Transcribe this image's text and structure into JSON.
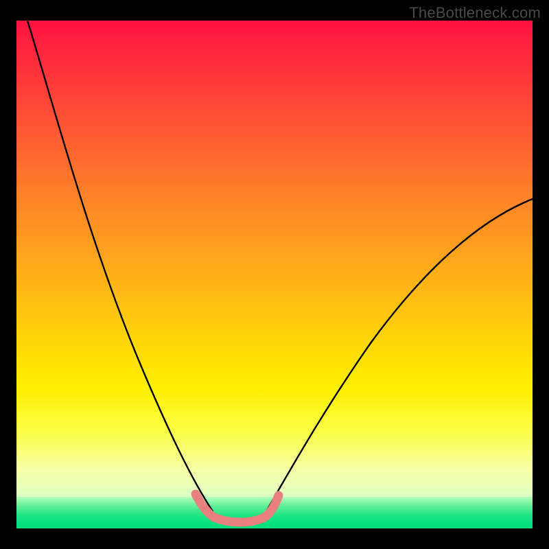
{
  "watermark": "TheBottleneck.com",
  "chart_data": {
    "type": "line",
    "title": "",
    "xlabel": "",
    "ylabel": "",
    "xlim": [
      0,
      100
    ],
    "ylim": [
      0,
      100
    ],
    "grid": false,
    "legend": false,
    "annotation_colors": {
      "top_gradient": "#ff1a3a",
      "mid_gradient": "#ffe000",
      "bottom_band": "#00e878"
    },
    "series": [
      {
        "name": "left-curve",
        "x": [
          2,
          6,
          10,
          15,
          20,
          25,
          30,
          34,
          37,
          40
        ],
        "y": [
          100,
          88,
          76,
          62,
          48,
          34,
          22,
          12,
          6,
          2
        ],
        "stroke": "#000000"
      },
      {
        "name": "right-curve",
        "x": [
          48,
          52,
          58,
          65,
          72,
          80,
          88,
          96,
          100
        ],
        "y": [
          2,
          6,
          14,
          24,
          34,
          44,
          53,
          60,
          63
        ],
        "stroke": "#000000"
      },
      {
        "name": "highlighted-minimum",
        "x": [
          35,
          37,
          39,
          41,
          43,
          45,
          47,
          49,
          50
        ],
        "y": [
          6,
          3,
          1.5,
          1.2,
          1.2,
          1.2,
          1.5,
          3,
          6
        ],
        "stroke": "#e7807f"
      }
    ]
  }
}
